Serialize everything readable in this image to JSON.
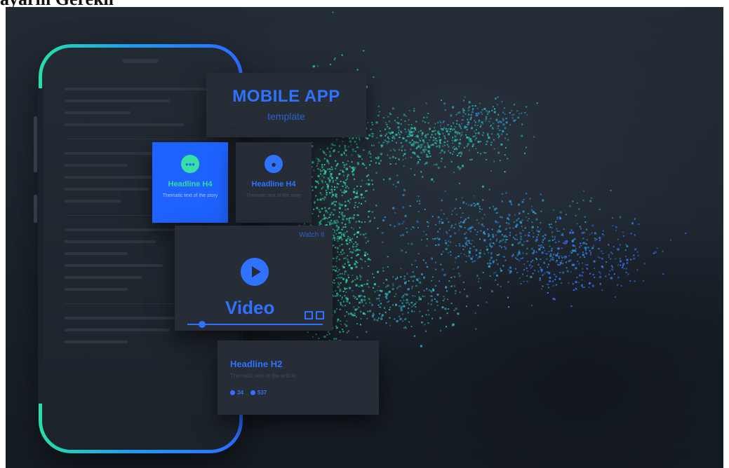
{
  "caption": {
    "text": "ayarın Gerekli"
  },
  "hero": {
    "title": "MOBILE APP",
    "subtitle": "template",
    "cards": {
      "chat": {
        "headline": "Headline H4",
        "text": "Thematic text of the story"
      },
      "profile": {
        "headline": "Headline H4",
        "text": "Thematic text of the story"
      },
      "video": {
        "top_label": "Watch it",
        "label": "Video"
      },
      "article": {
        "headline": "Headline H2",
        "text": "Thematic text of the article",
        "stat_1": "34",
        "stat_2": "537"
      }
    }
  },
  "icons": [
    "chat-bubble-icon",
    "user-icon",
    "play-icon",
    "fullscreen-icon",
    "comment-icon",
    "view-icon"
  ],
  "colors": {
    "background": "#1f262f",
    "card": "#262d37",
    "accent_blue": "#2f72ff",
    "accent_green": "#36d9a2",
    "rim_green": "#27e0a8",
    "rim_blue": "#2a6bff"
  }
}
